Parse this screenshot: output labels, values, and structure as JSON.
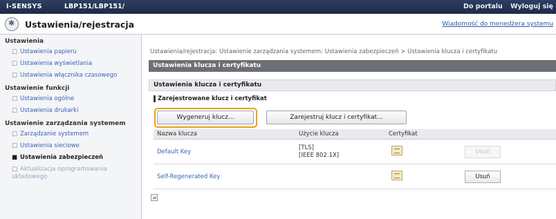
{
  "topbar": {
    "brand": "I-SENSYS",
    "model": "LBP151/LBP151/",
    "portal_link": "Do portalu",
    "logout_link": "Wyloguj się"
  },
  "titlebar": {
    "title": "Ustawienia/rejestracja",
    "message_link": "Wiadomość do menedżera systemu"
  },
  "sidebar": {
    "groups": [
      {
        "label": "Ustawienia",
        "items": [
          "Ustawienia papieru",
          "Ustawienia wyświetlania",
          "Ustawienia włącznika czasowego"
        ]
      },
      {
        "label": "Ustawienie funkcji",
        "items": [
          "Ustawienia ogólne",
          "Ustawienia drukarki"
        ]
      },
      {
        "label": "Ustawienie zarządzania systemem",
        "items": [
          "Zarządzanie systemem",
          "Ustawienia sieciowe",
          "Ustawienia zabezpieczeń",
          "Aktualizacja oprogramowania układowego"
        ]
      }
    ]
  },
  "main": {
    "breadcrumb": "Ustawienia/rejestracja: Ustawienie zarządzania systemem: Ustawienia zabezpieczeń > Ustawienia klucza i certyfikatu",
    "header_primary": "Ustawienia klucza i certyfikatu",
    "header_secondary": "Ustawienia klucza i certyfikatu",
    "section_label": "Zarejestrowane klucz i certyfikat",
    "generate_button": "Wygeneruj klucz...",
    "register_button": "Zarejestruj klucz i certyfikat...",
    "table": {
      "columns": [
        "Nazwa klucza",
        "Użycie klucza",
        "Certyfikat",
        ""
      ],
      "rows": [
        {
          "name": "Default Key",
          "usage": [
            "[TLS]",
            "[IEEE 802.1X]"
          ],
          "delete": "Usuń",
          "delete_enabled": false
        },
        {
          "name": "Self-Regenerated Key",
          "usage": [
            "",
            ""
          ],
          "delete": "Usuń",
          "delete_enabled": true
        }
      ]
    }
  },
  "colors": {
    "topbar": "#1d2b48",
    "header_dark": "#6c6f74",
    "focus_ring": "#f29b1d",
    "link": "#3a63b8"
  }
}
